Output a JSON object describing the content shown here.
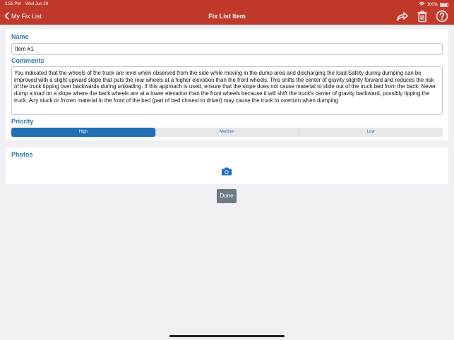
{
  "status": {
    "time": "3:55 PM",
    "date": "Wed Jun 29",
    "battery": "100%"
  },
  "nav": {
    "back_label": "My Fix List",
    "title": "Fix List Item"
  },
  "form": {
    "name_label": "Name",
    "name_value": "Item #1",
    "comments_label": "Comments",
    "comments_value": "You indicated that the wheels of the truck are level when observed from the side while moving in the dump area and discharging the load.Safety during dumping can be improved with a slight upward slope that puts the rear wheels at a higher elevation than the front wheels. This shifts the center of gravity slightly forward and reduces the risk of the truck tipping over backwards during unloading.  If this approach is used, ensure that the slope does not cause material to slide out of the truck bed from the back. Never dump a load on a slope where the back wheels are at a lower elevation than the front wheels because it will shift the truck's center of gravity backward, possibly tipping the truck. Any stuck or frozen material in the front of the bed (part of bed closest to driver) may cause the truck to overturn when dumping.",
    "priority_label": "Priority",
    "priority_options": [
      "High",
      "Medium",
      "Low"
    ],
    "priority_selected": "High"
  },
  "photos": {
    "label": "Photos"
  },
  "done_label": "Done",
  "colors": {
    "header": "#c0392b",
    "accent": "#1f6fb4",
    "label": "#2a7ab5",
    "done": "#6e7b84"
  },
  "icons": [
    "chevron-left-icon",
    "share-icon",
    "trash-icon",
    "help-icon",
    "camera-icon",
    "wifi-icon",
    "battery-icon"
  ]
}
